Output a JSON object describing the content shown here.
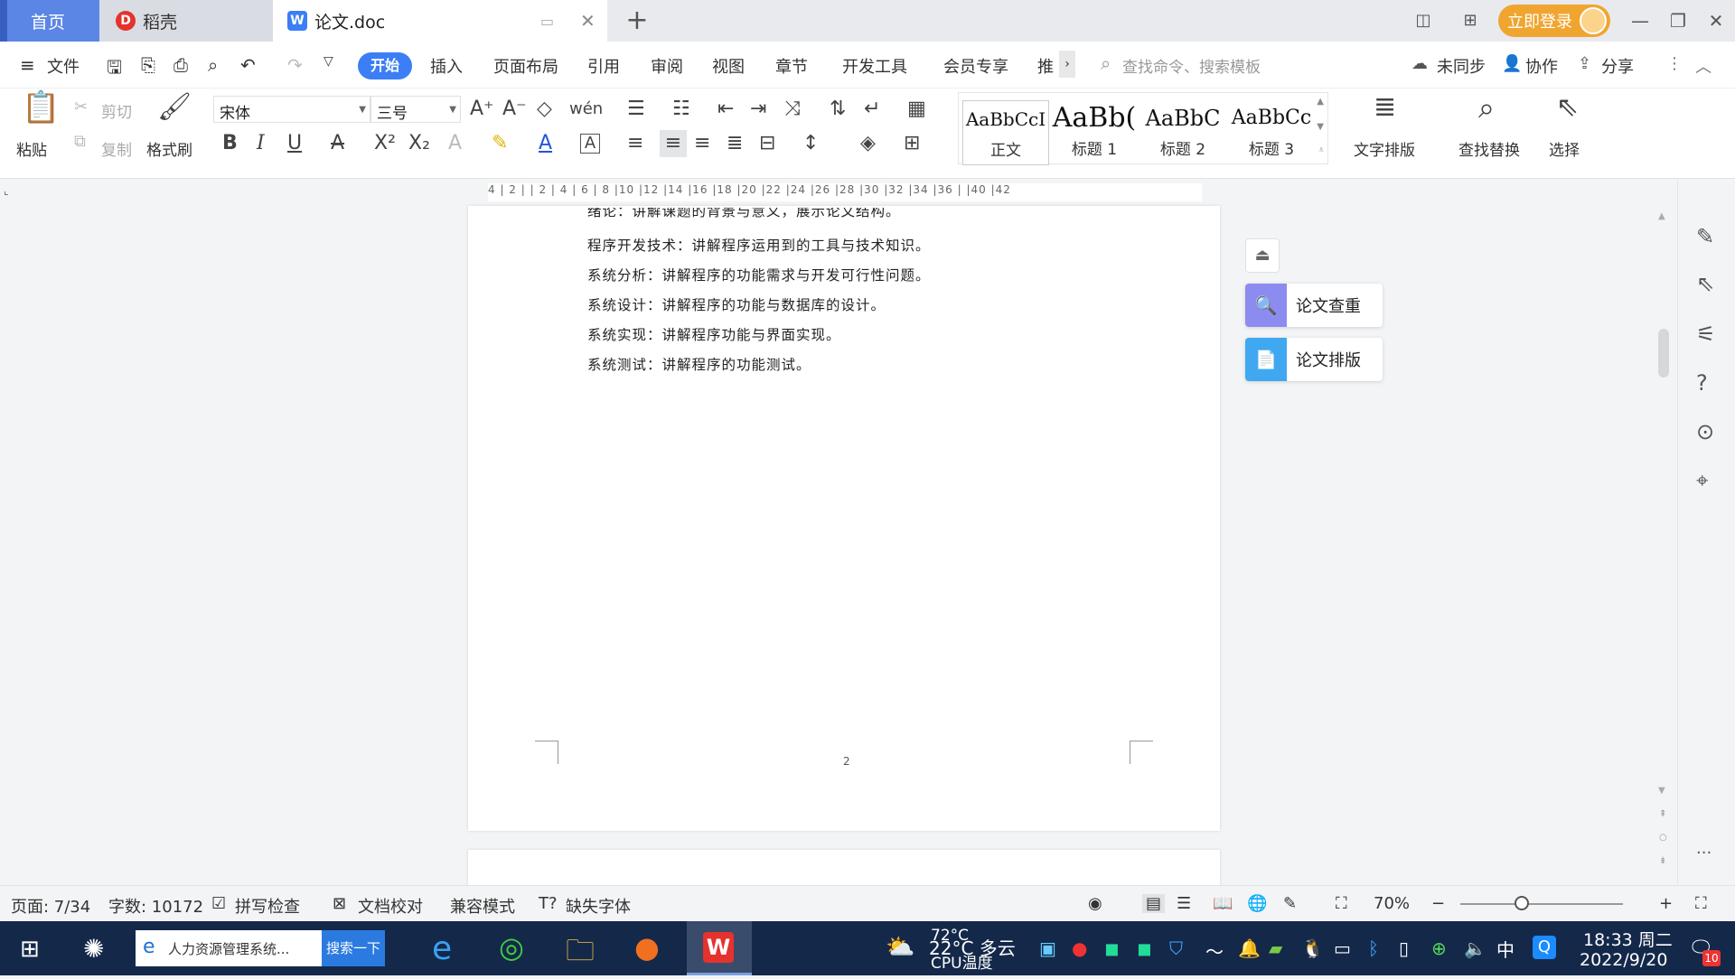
{
  "tabs": {
    "home": "首页",
    "daoke": "稻壳",
    "doc": "论文.doc"
  },
  "titlebar": {
    "login": "立即登录"
  },
  "menu": {
    "file": "文件",
    "start": "开始",
    "insert": "插入",
    "layout": "页面布局",
    "reference": "引用",
    "review": "审阅",
    "view": "视图",
    "chapter": "章节",
    "devtools": "开发工具",
    "member": "会员专享",
    "more": "推",
    "search_placeholder": "查找命令、搜索模板",
    "unsynced": "未同步",
    "collab": "协作",
    "share": "分享"
  },
  "ribbon": {
    "paste": "粘贴",
    "cut": "剪切",
    "copy": "复制",
    "format_painter": "格式刷",
    "font_name": "宋体",
    "font_size": "三号",
    "styles": [
      {
        "preview": "AaBbCcI",
        "name": "正文"
      },
      {
        "preview": "AaBb(",
        "name": "标题 1"
      },
      {
        "preview": "AaBbC",
        "name": "标题 2"
      },
      {
        "preview": "AaBbCc",
        "name": "标题 3"
      }
    ],
    "text_layout": "文字排版",
    "find_replace": "查找替换",
    "select": "选择"
  },
  "ruler": {
    "ticks": "4 | 2 | | 2 | 4 | 6 | 8 |10 |12 |14 |16 |18 |20 |22 |24 |26 |28 |30 |32 |34 |36 | |40 |42"
  },
  "document": {
    "lines": [
      "绪论：讲解课题的背景与意义，展示论文结构。",
      "程序开发技术：讲解程序运用到的工具与技术知识。",
      "系统分析：讲解程序的功能需求与开发可行性问题。",
      "系统设计：讲解程序的功能与数据库的设计。",
      "系统实现：讲解程序功能与界面实现。",
      "系统测试：讲解程序的功能测试。"
    ],
    "page_number": "2"
  },
  "side_panel": {
    "check": "论文查重",
    "format": "论文排版"
  },
  "status": {
    "page": "页面: 7/34",
    "words": "字数: 10172",
    "spell": "拼写检查",
    "proof": "文档校对",
    "compat": "兼容模式",
    "missing_font": "缺失字体",
    "zoom": "70%"
  },
  "taskbar": {
    "search_text": "人力资源管理系统...",
    "search_btn": "搜索一下",
    "weather_temp": "22°C 多云",
    "cpu_temp": "72°C",
    "cpu_label": "CPU温度",
    "ime": "中",
    "time": "18:33 周二",
    "date": "2022/9/20",
    "notif_count": "10"
  },
  "colors": {
    "accent": "#3b7ef5",
    "login": "#f0a530",
    "taskbar": "#14284a",
    "float_check": "#8c8cf0",
    "float_format": "#3fa8f0"
  }
}
